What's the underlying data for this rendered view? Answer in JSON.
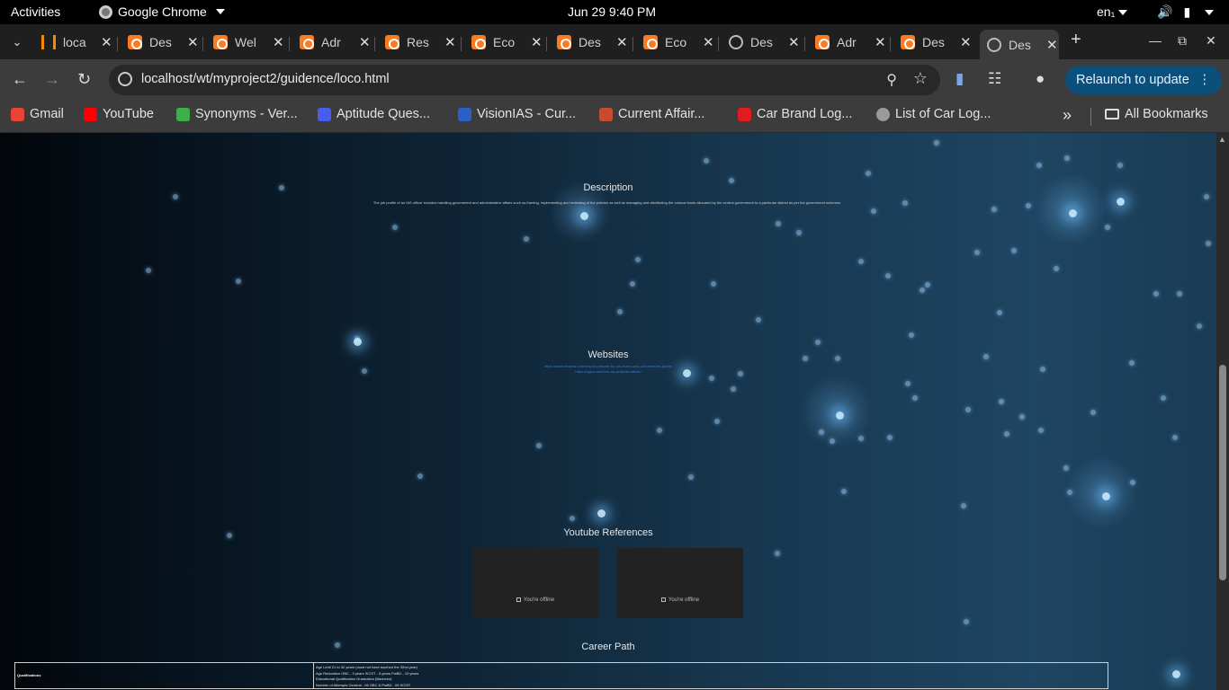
{
  "system": {
    "activities": "Activities",
    "app_name": "Google Chrome",
    "clock": "Jun 29   9:40 PM",
    "lang": "en₁"
  },
  "tabs": [
    {
      "title": "loca",
      "icon": "stack-icon"
    },
    {
      "title": "Des",
      "icon": "xampp-icon"
    },
    {
      "title": "Wel",
      "icon": "xampp-icon"
    },
    {
      "title": "Adr",
      "icon": "xampp-icon"
    },
    {
      "title": "Res",
      "icon": "xampp-icon"
    },
    {
      "title": "Eco",
      "icon": "xampp-icon"
    },
    {
      "title": "Des",
      "icon": "xampp-icon"
    },
    {
      "title": "Eco",
      "icon": "xampp-icon"
    },
    {
      "title": "Des",
      "icon": "globe-icon"
    },
    {
      "title": "Adr",
      "icon": "xampp-icon"
    },
    {
      "title": "Des",
      "icon": "xampp-icon"
    },
    {
      "title": "Des",
      "icon": "globe-icon",
      "active": true
    }
  ],
  "toolbar": {
    "url": "localhost/wt/myproject2/guidence/loco.html",
    "relaunch_label": "Relaunch to update"
  },
  "bookmarks": [
    {
      "label": "Gmail",
      "icon": "gmail-icon",
      "color": "#ea4335"
    },
    {
      "label": "YouTube",
      "icon": "youtube-icon",
      "color": "#ff0000"
    },
    {
      "label": "Synonyms - Ver...",
      "icon": "synonyms-icon",
      "color": "#3fae49"
    },
    {
      "label": "Aptitude Ques...",
      "icon": "aptitude-icon",
      "color": "#4a5cf0"
    },
    {
      "label": "VisionIAS - Cur...",
      "icon": "visionias-icon",
      "color": "#2b61c4"
    },
    {
      "label": "Current Affair...",
      "icon": "current-affairs-icon",
      "color": "#c84b31"
    },
    {
      "label": "Car Brand Log...",
      "icon": "car-brand-icon",
      "color": "#e11b22"
    },
    {
      "label": "List of Car Log...",
      "icon": "globe-icon",
      "color": "#9a9a9a"
    }
  ],
  "bookmarks_overflow": "»",
  "all_bookmarks": "All Bookmarks",
  "page": {
    "description_heading": "Description",
    "description_text": "The job profile of an IAS officer includes handling government and administrative affairs such as framing, implementing and reviewing of the policies as well as managing and distributing the various funds allocated by the central government to a particular district as per the government schemes.",
    "websites_heading": "Websites",
    "website_links": [
      "https://www.clearias.com/how-to-prepare-for-ias-exam-upsc-civil-services-guide/",
      "https://byjus.com/free-ias-prep/ias-officer/"
    ],
    "youtube_heading": "Youtube References",
    "youtube_boxes": [
      {
        "status": "You're offline"
      },
      {
        "status": "You're offline"
      }
    ],
    "career_heading": "Career Path",
    "career_table": {
      "label": "Qualifications",
      "lines": [
        "Age Limit 21 to 32 years (must not have touched the 32nd year)",
        "Age Relaxation OBC - 3 years SC/ST - 5 years PwBD - 10 years",
        "Educational Qualification Graduation (Bachelor)",
        "Number of Attempts General - 06 OBC & PwBD - 09 SC/ST"
      ]
    }
  }
}
